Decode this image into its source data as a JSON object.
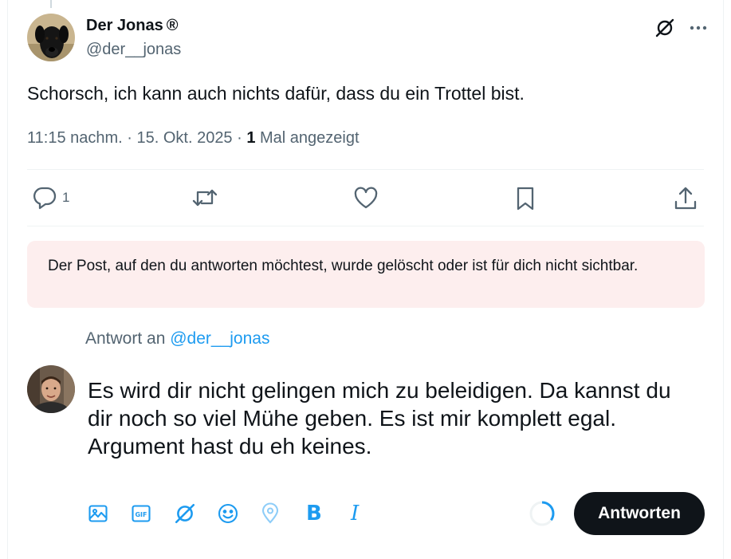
{
  "author": {
    "name": "Der Jonas",
    "badge": "®",
    "handle": "@der__jonas"
  },
  "post": {
    "text": "Schorsch, ich kann auch nichts dafür, dass du ein Trottel bist.",
    "time": "11:15 nachm. · 15. Okt. 2025 · ",
    "views_count": "1",
    "views_label": " Mal angezeigt"
  },
  "actions": {
    "reply_count": "1"
  },
  "notice": {
    "text": "Der Post, auf den du antworten möchtest, wurde gelöscht oder ist für dich nicht sichtbar."
  },
  "reply": {
    "prefix": "Antwort an ",
    "target": "@der__jonas",
    "draft": "Es wird dir nicht gelingen mich zu beleidigen. Da kannst du dir noch so viel Mühe geben. Es ist mir komplett egal. Argument hast du eh keines.",
    "submit_label": "Antworten",
    "progress": 0.35
  },
  "toolbar": {
    "bold_label": "B",
    "italic_label": "I"
  },
  "icons": [
    "grok-icon",
    "more-icon",
    "reply-icon",
    "repost-icon",
    "like-icon",
    "bookmark-icon",
    "share-icon",
    "image-icon",
    "gif-icon",
    "grok-compose-icon",
    "emoji-icon",
    "location-icon"
  ],
  "colors": {
    "accent": "#1d9bf0",
    "text": "#0f1419",
    "secondary": "#536471",
    "notice_bg": "#fdeeee",
    "button": "#0f1419"
  }
}
